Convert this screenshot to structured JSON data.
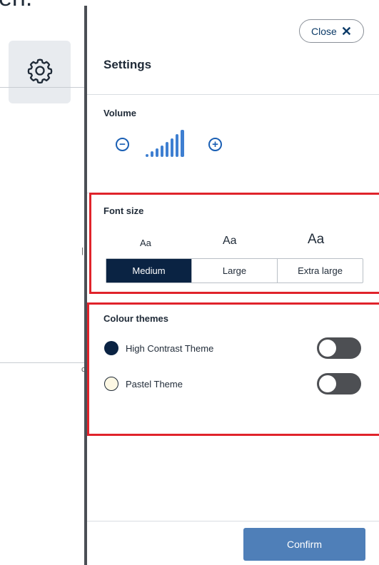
{
  "background": {
    "text_fragment": "en.",
    "settings_tile": {
      "icon": "gear-icon"
    }
  },
  "panel": {
    "title": "Settings",
    "close_label": "Close",
    "close_icon": "close-x-icon",
    "volume": {
      "label": "Volume",
      "level_fraction": 1.0,
      "decrease_icon": "minus-circle-icon",
      "increase_icon": "plus-circle-icon"
    },
    "font_size": {
      "label": "Font size",
      "previews": [
        "Aa",
        "Aa",
        "Aa"
      ],
      "options": [
        "Medium",
        "Large",
        "Extra large"
      ],
      "selected": "Medium"
    },
    "colour_themes": {
      "label": "Colour themes",
      "themes": [
        {
          "name": "High Contrast Theme",
          "swatch_color": "#0a2343",
          "enabled": false
        },
        {
          "name": "Pastel Theme",
          "swatch_color": "#fdf8e4",
          "enabled": false
        }
      ]
    },
    "confirm_label": "Confirm"
  },
  "colors": {
    "accent_blue": "#1a5fb4",
    "selected_navy": "#0a2343",
    "confirm_button": "#4f7fb8",
    "highlight_red": "#e0232b",
    "toggle_off": "#4d4f53"
  }
}
